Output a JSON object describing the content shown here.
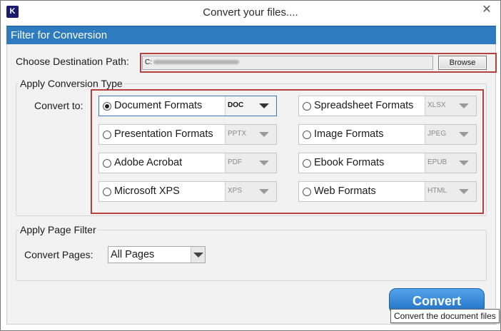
{
  "window": {
    "title": "Convert your files....",
    "app_icon_letter": "K",
    "close_symbol": "✕"
  },
  "section_header": "Filter for Conversion",
  "destination": {
    "label": "Choose Destination Path:",
    "value_prefix": "C:",
    "browse_label": "Browse"
  },
  "conversion": {
    "group_title": "Apply Conversion Type",
    "convert_to_label": "Convert to:",
    "formats": [
      {
        "label": "Document Formats",
        "value": "DOC",
        "selected": true
      },
      {
        "label": "Spreadsheet Formats",
        "value": "XLSX",
        "selected": false
      },
      {
        "label": "Presentation Formats",
        "value": "PPTX",
        "selected": false
      },
      {
        "label": "Image Formats",
        "value": "JPEG",
        "selected": false
      },
      {
        "label": "Adobe Acrobat",
        "value": "PDF",
        "selected": false
      },
      {
        "label": "Ebook Formats",
        "value": "EPUB",
        "selected": false
      },
      {
        "label": "Microsoft XPS",
        "value": "XPS",
        "selected": false
      },
      {
        "label": "Web Formats",
        "value": "HTML",
        "selected": false
      }
    ]
  },
  "page_filter": {
    "group_title": "Apply Page Filter",
    "convert_pages_label": "Convert Pages:",
    "selected": "All Pages"
  },
  "convert_button": "Convert",
  "tooltip": "Convert the document files",
  "colors": {
    "header_blue": "#2f7bbf",
    "highlight_red": "#b5413d",
    "button_blue": "#1f6fc4"
  }
}
